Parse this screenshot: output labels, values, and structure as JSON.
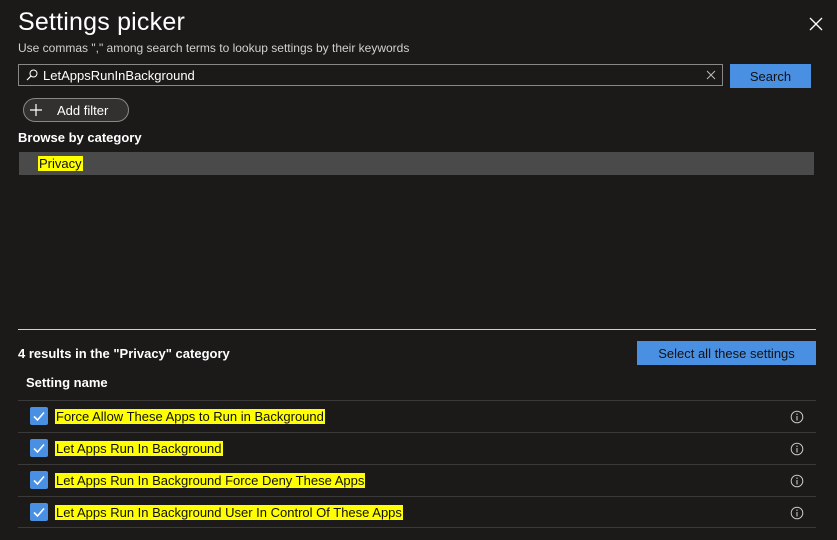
{
  "panel": {
    "title": "Settings picker",
    "subtitle": "Use commas \",\" among search terms to lookup settings by their keywords"
  },
  "search": {
    "value": "LetAppsRunInBackground",
    "button_label": "Search"
  },
  "filter": {
    "add_label": "Add filter"
  },
  "browse": {
    "title": "Browse by category",
    "categories": [
      "Privacy"
    ]
  },
  "results": {
    "count_label": "4 results in the \"Privacy\" category",
    "select_all_label": "Select all these settings",
    "column_header": "Setting name",
    "items": [
      {
        "name": "Force Allow These Apps to Run in Background",
        "checked": true
      },
      {
        "name": "Let Apps Run In Background",
        "checked": true
      },
      {
        "name": "Let Apps Run In Background Force Deny These Apps",
        "checked": true
      },
      {
        "name": "Let Apps Run In Background User In Control Of These Apps",
        "checked": true
      }
    ]
  },
  "colors": {
    "background": "#1b1a19",
    "accent": "#4a90e2",
    "highlight": "#ffff00",
    "selected_row": "#4a4a4a"
  },
  "icons": [
    "close-icon",
    "search-icon",
    "clear-icon",
    "plus-icon",
    "checkmark-icon",
    "info-icon"
  ]
}
